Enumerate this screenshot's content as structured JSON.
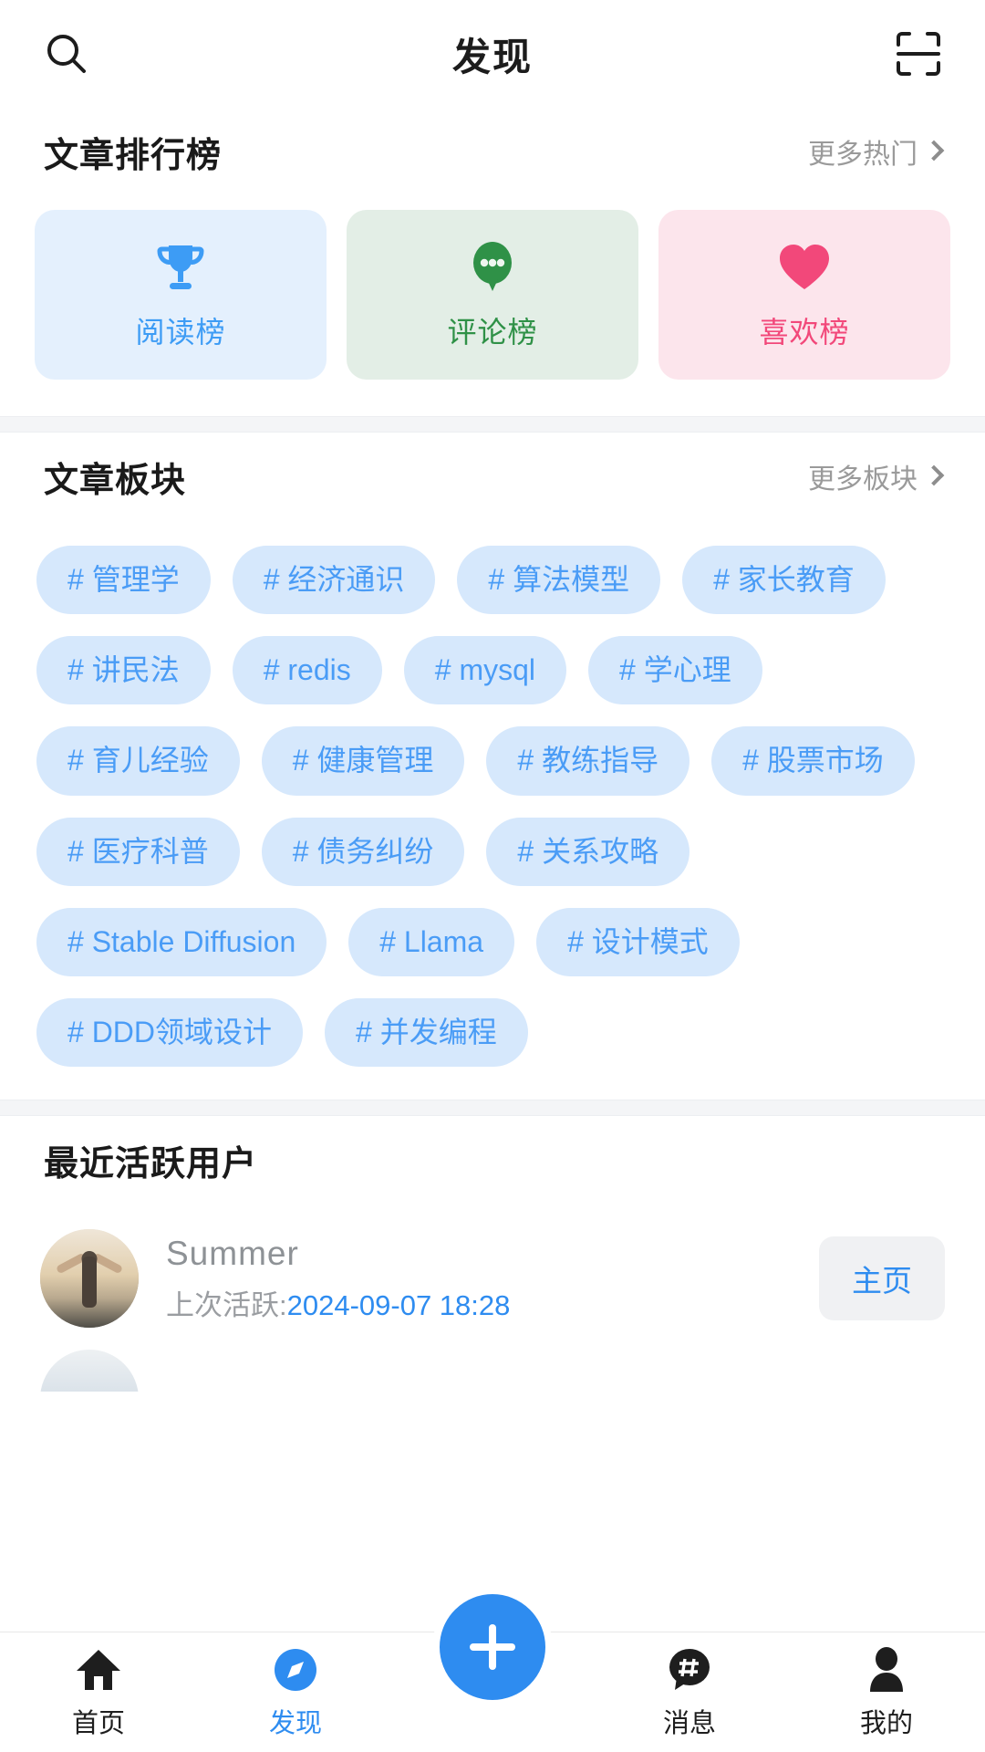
{
  "header": {
    "title": "发现",
    "search_icon": "search-icon",
    "scan_icon": "scan-icon"
  },
  "rank_section": {
    "title": "文章排行榜",
    "more_label": "更多热门",
    "cards": [
      {
        "label": "阅读榜",
        "icon": "trophy-icon",
        "bg": "#e4f0fd",
        "fg": "#3d9cf5"
      },
      {
        "label": "评论榜",
        "icon": "comment-bubble-icon",
        "bg": "#e3eee6",
        "fg": "#2f9147"
      },
      {
        "label": "喜欢榜",
        "icon": "heart-icon",
        "bg": "#fce5ec",
        "fg": "#f2487a"
      }
    ]
  },
  "tag_section": {
    "title": "文章板块",
    "more_label": "更多板块",
    "tags": [
      "# 管理学",
      "# 经济通识",
      "# 算法模型",
      "# 家长教育",
      "# 讲民法",
      "# redis",
      "# mysql",
      "# 学心理",
      "# 育儿经验",
      "# 健康管理",
      "# 教练指导",
      "# 股票市场",
      "# 医疗科普",
      "# 债务纠纷",
      "# 关系攻略",
      "# Stable Diffusion",
      "# Llama",
      "# 设计模式",
      "# DDD领域设计",
      "# 并发编程"
    ]
  },
  "users_section": {
    "title": "最近活跃用户",
    "users": [
      {
        "name": "Summer",
        "active_prefix": "上次活跃:",
        "active_time": "2024-09-07 18:28",
        "action_label": "主页"
      }
    ]
  },
  "tabbar": {
    "items": [
      {
        "label": "首页",
        "icon": "home-icon",
        "active": false
      },
      {
        "label": "发现",
        "icon": "compass-icon",
        "active": true
      },
      {
        "label": "消息",
        "icon": "message-hash-icon",
        "active": false
      },
      {
        "label": "我的",
        "icon": "person-icon",
        "active": false
      }
    ],
    "fab_icon": "plus-icon"
  },
  "colors": {
    "accent": "#2e8cf0",
    "tag_bg": "#d6e8fc",
    "tag_fg": "#4a9cf6",
    "band": "#f4f5f7"
  }
}
